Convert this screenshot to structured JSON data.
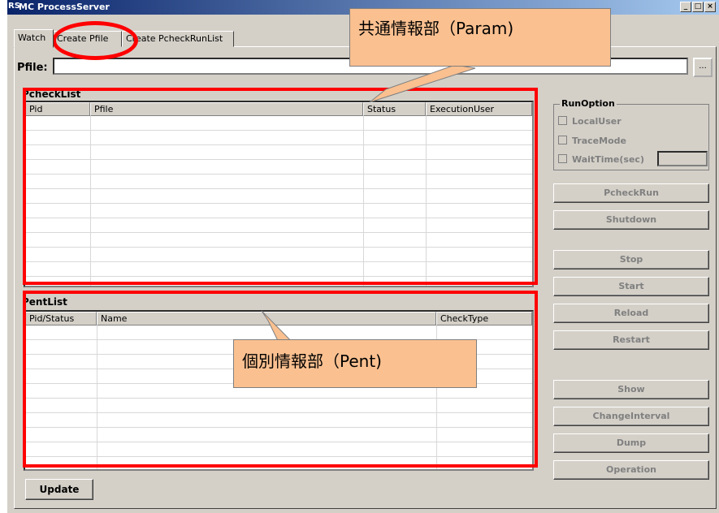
{
  "window": {
    "title": "MC ProcessServer",
    "app_icon": "RS",
    "min_label": "_",
    "max_label": "□",
    "close_label": "×"
  },
  "tabs": [
    {
      "label": "Watch",
      "active": true
    },
    {
      "label": "Create Pfile",
      "active": false
    },
    {
      "label": "Create PcheckRunList",
      "active": false
    }
  ],
  "pfile": {
    "label": "Pfile:",
    "value": "",
    "browse_label": "..."
  },
  "pchecklist": {
    "title": "PcheckList",
    "columns": [
      "Pid",
      "Pfile",
      "Status",
      "ExecutionUser"
    ]
  },
  "pentlist": {
    "title": "PentList",
    "columns": [
      "Pid/Status",
      "Name",
      "CheckType"
    ]
  },
  "run_option": {
    "title": "RunOption",
    "local_user": "LocalUser",
    "trace_mode": "TraceMode",
    "wait_time": "WaitTime(sec)",
    "wait_value": ""
  },
  "buttons": {
    "pcheck_run": "PcheckRun",
    "shutdown": "Shutdown",
    "stop": "Stop",
    "start": "Start",
    "reload": "Reload",
    "restart": "Restart",
    "show": "Show",
    "change_interval": "ChangeInterval",
    "dump": "Dump",
    "operation": "Operation",
    "update": "Update"
  },
  "annotations": {
    "common_info": "共通情報部（Param)",
    "individual_info": "個別情報部（Pent)",
    "highlight_color": "#ff0000",
    "callout_color": "#fac090"
  }
}
